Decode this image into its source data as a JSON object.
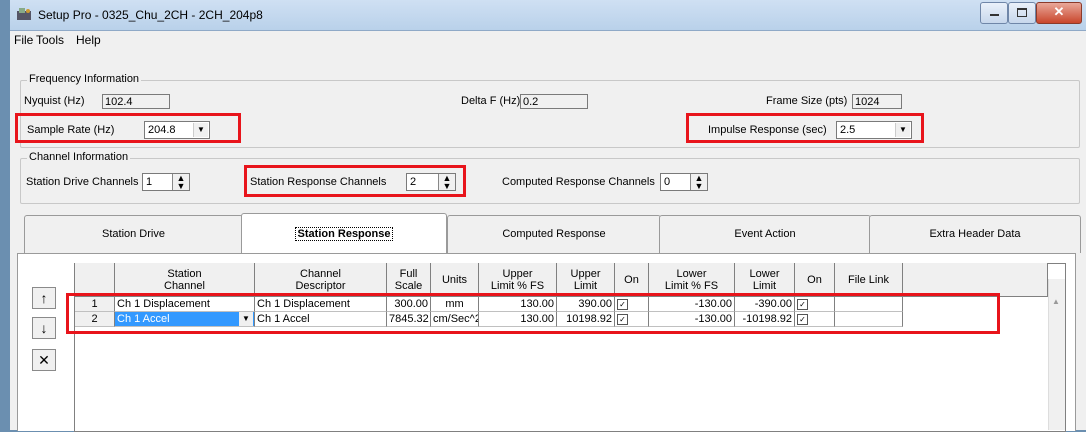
{
  "window": {
    "title": "Setup Pro - 0325_Chu_2CH - 2CH_204p8"
  },
  "menu": [
    "File",
    "Tools",
    "Help"
  ],
  "frequency": {
    "group_title": "Frequency Information",
    "nyquist_label": "Nyquist (Hz)",
    "nyquist_value": "102.4",
    "deltaf_label": "Delta F (Hz)",
    "deltaf_value": "0.2",
    "framesize_label": "Frame Size (pts)",
    "framesize_value": "1024",
    "samplerate_label": "Sample Rate (Hz)",
    "samplerate_value": "204.8",
    "impulse_label": "Impulse Response (sec)",
    "impulse_value": "2.5"
  },
  "channel": {
    "group_title": "Channel Information",
    "drive_label": "Station Drive Channels",
    "drive_value": "1",
    "response_label": "Station Response Channels",
    "response_value": "2",
    "computed_label": "Computed Response Channels",
    "computed_value": "0"
  },
  "tabs": [
    "Station Drive",
    "Station Response",
    "Computed Response",
    "Event Action",
    "Extra Header Data"
  ],
  "active_tab": "Station Response",
  "grid": {
    "headers": [
      "Station\nChannel",
      "Channel\nDescriptor",
      "Full\nScale",
      "Units",
      "Upper\nLimit % FS",
      "Upper\nLimit",
      "On",
      "Lower\nLimit % FS",
      "Lower\nLimit",
      "On",
      "File Link"
    ],
    "rows": [
      {
        "num": "1",
        "station_channel": "Ch 1 Displacement",
        "descriptor": "Ch 1 Displacement",
        "full_scale": "300.00",
        "units": "mm",
        "upper_pct": "130.00",
        "upper": "390.00",
        "upper_on": "✓",
        "lower_pct": "-130.00",
        "lower": "-390.00",
        "lower_on": "✓",
        "file_link": ""
      },
      {
        "num": "2",
        "station_channel": "Ch 1 Accel",
        "descriptor": "Ch 1 Accel",
        "full_scale": "7845.32",
        "units": "cm/Sec^2",
        "upper_pct": "130.00",
        "upper": "10198.92",
        "upper_on": "✓",
        "lower_pct": "-130.00",
        "lower": "-10198.92",
        "lower_on": "✓",
        "file_link": ""
      }
    ]
  },
  "side_buttons": {
    "up": "↑",
    "down": "↓",
    "delete": "✕"
  },
  "colors": {
    "highlight": "#e8141b",
    "selection": "#3399ff"
  }
}
